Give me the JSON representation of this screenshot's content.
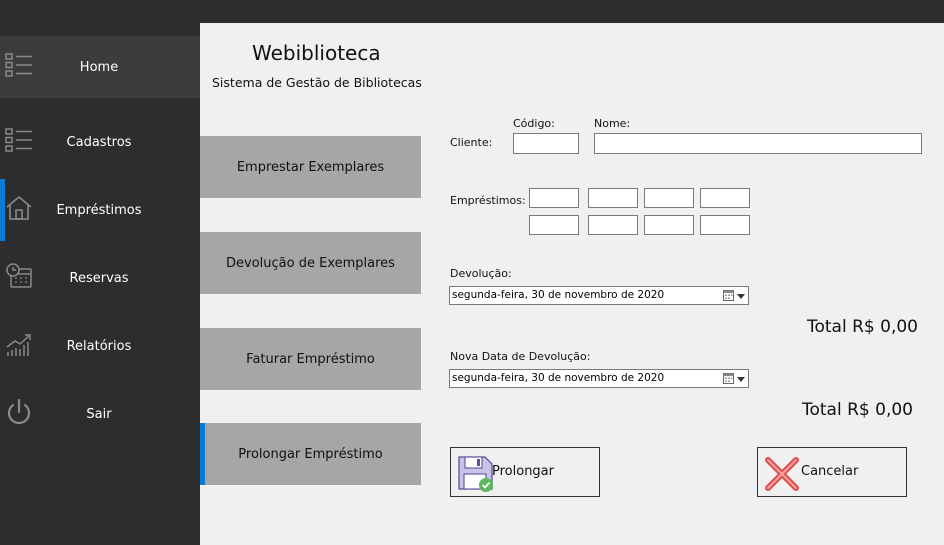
{
  "sidebar": {
    "items": [
      {
        "label": "Home",
        "icon": "list-icon"
      },
      {
        "label": "Cadastros",
        "icon": "list-icon"
      },
      {
        "label": "Empréstimos",
        "icon": "house-icon"
      },
      {
        "label": "Reservas",
        "icon": "calendar-clock-icon"
      },
      {
        "label": "Relatórios",
        "icon": "chart-icon"
      },
      {
        "label": "Sair",
        "icon": "power-icon"
      }
    ],
    "active": "Empréstimos"
  },
  "header": {
    "title": "Webiblioteca",
    "subtitle": "Sistema de Gestão de Bibliotecas"
  },
  "submenu": [
    {
      "label": "Emprestar Exemplares"
    },
    {
      "label": "Devolução de Exemplares"
    },
    {
      "label": "Faturar Empréstimo"
    },
    {
      "label": "Prolongar Empréstimo"
    }
  ],
  "form": {
    "client_label": "Cliente:",
    "code_label": "Código:",
    "name_label": "Nome:",
    "code_value": "",
    "name_value": "",
    "loans_label": "Empréstimos:",
    "return_label": "Devolução:",
    "return_date": "segunda-feira, 30 de novembro de 2020",
    "total1": "Total R$ 0,00",
    "new_return_label": "Nova Data de Devolução:",
    "new_return_date": "segunda-feira, 30 de novembro de 2020",
    "total2": "Total R$ 0,00"
  },
  "buttons": {
    "prolong": "Prolongar",
    "cancel": "Cancelar"
  },
  "colors": {
    "sidebar_bg": "#2d2d30",
    "accent": "#0a7bd4",
    "submenu_bg": "#a6a6a6"
  }
}
